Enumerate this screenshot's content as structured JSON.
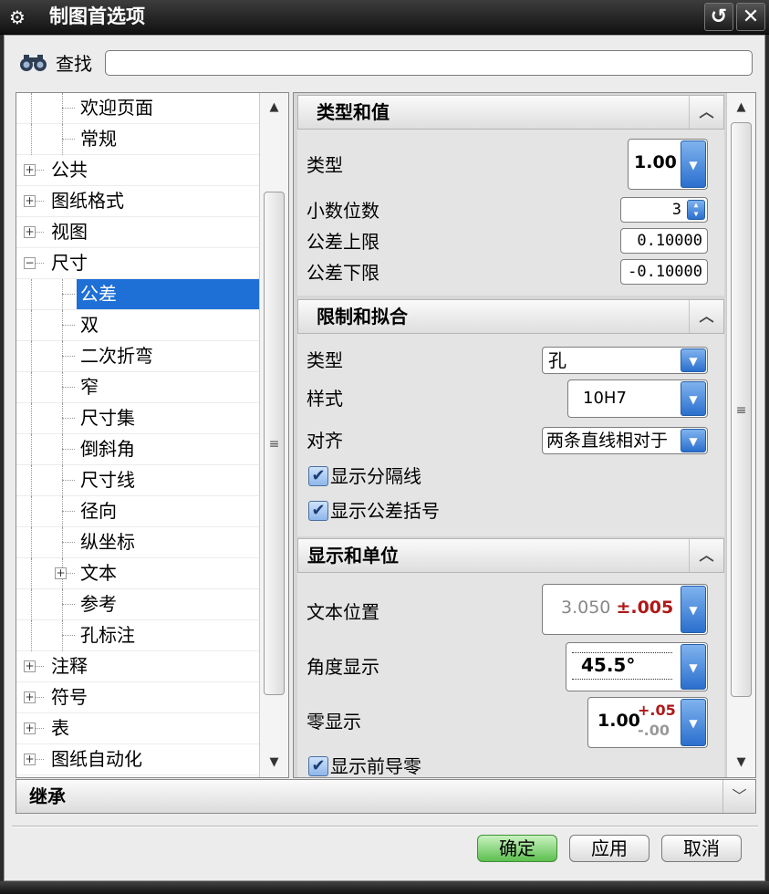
{
  "window": {
    "title": "制图首选项",
    "gear_icon": "⚙",
    "reset_icon": "↺",
    "close_icon": "✕"
  },
  "find": {
    "label": "查找",
    "value": "",
    "placeholder": ""
  },
  "tree": {
    "items": [
      {
        "label": "欢迎页面",
        "level": 2,
        "expander": null,
        "selected": false
      },
      {
        "label": "常规",
        "level": 2,
        "expander": null,
        "selected": false
      },
      {
        "label": "公共",
        "level": 1,
        "expander": "+",
        "selected": false
      },
      {
        "label": "图纸格式",
        "level": 1,
        "expander": "+",
        "selected": false
      },
      {
        "label": "视图",
        "level": 1,
        "expander": "+",
        "selected": false
      },
      {
        "label": "尺寸",
        "level": 1,
        "expander": "−",
        "selected": false
      },
      {
        "label": "公差",
        "level": 2,
        "expander": null,
        "selected": true
      },
      {
        "label": "双",
        "level": 2,
        "expander": null,
        "selected": false
      },
      {
        "label": "二次折弯",
        "level": 2,
        "expander": null,
        "selected": false
      },
      {
        "label": "窄",
        "level": 2,
        "expander": null,
        "selected": false
      },
      {
        "label": "尺寸集",
        "level": 2,
        "expander": null,
        "selected": false
      },
      {
        "label": "倒斜角",
        "level": 2,
        "expander": null,
        "selected": false
      },
      {
        "label": "尺寸线",
        "level": 2,
        "expander": null,
        "selected": false
      },
      {
        "label": "径向",
        "level": 2,
        "expander": null,
        "selected": false
      },
      {
        "label": "纵坐标",
        "level": 2,
        "expander": null,
        "selected": false
      },
      {
        "label": "文本",
        "level": 2,
        "expander": "+",
        "selected": false
      },
      {
        "label": "参考",
        "level": 2,
        "expander": null,
        "selected": false
      },
      {
        "label": "孔标注",
        "level": 2,
        "expander": null,
        "selected": false
      },
      {
        "label": "注释",
        "level": 1,
        "expander": "+",
        "selected": false
      },
      {
        "label": "符号",
        "level": 1,
        "expander": "+",
        "selected": false
      },
      {
        "label": "表",
        "level": 1,
        "expander": "+",
        "selected": false
      },
      {
        "label": "图纸自动化",
        "level": 1,
        "expander": "+",
        "selected": false
      }
    ]
  },
  "groups": {
    "type_value": {
      "title": "类型和值",
      "type_label": "类型",
      "type_value": "1.00",
      "decimals_label": "小数位数",
      "decimals_value": "3",
      "upper_label": "公差上限",
      "upper_value": "0.10000",
      "lower_label": "公差下限",
      "lower_value": "-0.10000"
    },
    "limits_fits": {
      "title": "限制和拟合",
      "type_label": "类型",
      "type_value": "孔",
      "style_label": "样式",
      "style_value": "10H7",
      "align_label": "对齐",
      "align_value": "两条直线相对于",
      "show_separator": "显示分隔线",
      "show_brackets": "显示公差括号"
    },
    "display_units": {
      "title": "显示和单位",
      "text_pos_label": "文本位置",
      "text_pos_nominal": "3.050",
      "text_pos_tol": "±.005",
      "angle_label": "角度显示",
      "angle_value": "45.5°",
      "zero_label": "零显示",
      "zero_nominal": "1.00",
      "zero_upper": "+.05",
      "zero_lower": "-.00",
      "show_leading_zero": "显示前导零"
    }
  },
  "inherit": {
    "label": "继承"
  },
  "buttons": {
    "ok": "确定",
    "apply": "应用",
    "cancel": "取消"
  },
  "colors": {
    "selection": "#1e6fd6",
    "ok_button": "#5cbf4f",
    "tolerance_red": "#b01818",
    "dropdown_blue": "#2b6fce"
  }
}
